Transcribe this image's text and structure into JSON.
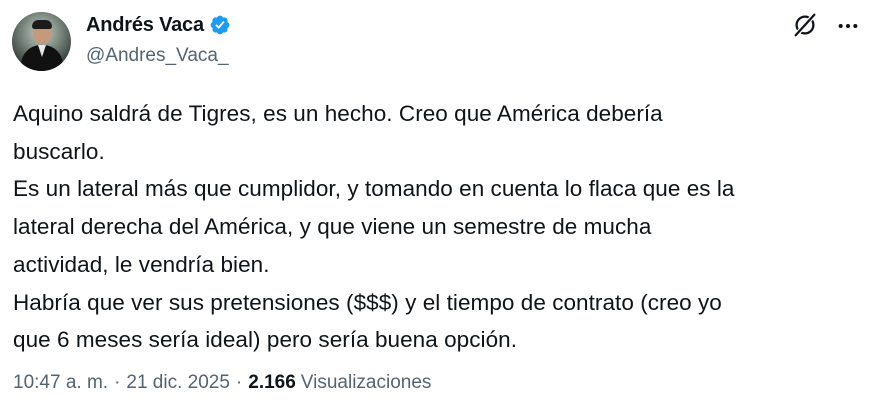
{
  "author": {
    "display_name": "Andrés Vaca",
    "handle": "@Andres_Vaca_",
    "verified": true,
    "verified_color": "#1d9bf0"
  },
  "actions": {
    "grok_icon": "grok-icon",
    "more_icon": "more-icon"
  },
  "tweet": {
    "lines": [
      "Aquino saldrá de Tigres, es un hecho. Creo que América debería",
      "buscarlo.",
      "Es un lateral más que cumplidor, y tomando en cuenta lo flaca que es la",
      "lateral derecha del América, y que viene un semestre de mucha",
      "actividad, le vendría bien.",
      "Habría que ver sus pretensiones ($$$) y el tiempo de contrato (creo yo",
      "que 6 meses sería ideal) pero sería buena opción."
    ]
  },
  "meta": {
    "time": "10:47 a. m.",
    "separator": "·",
    "date": "21 dic. 2025",
    "views_count": "2.166",
    "views_label": "Visualizaciones"
  },
  "colors": {
    "text": "#0f1419",
    "secondary": "#536471",
    "accent": "#1d9bf0"
  }
}
